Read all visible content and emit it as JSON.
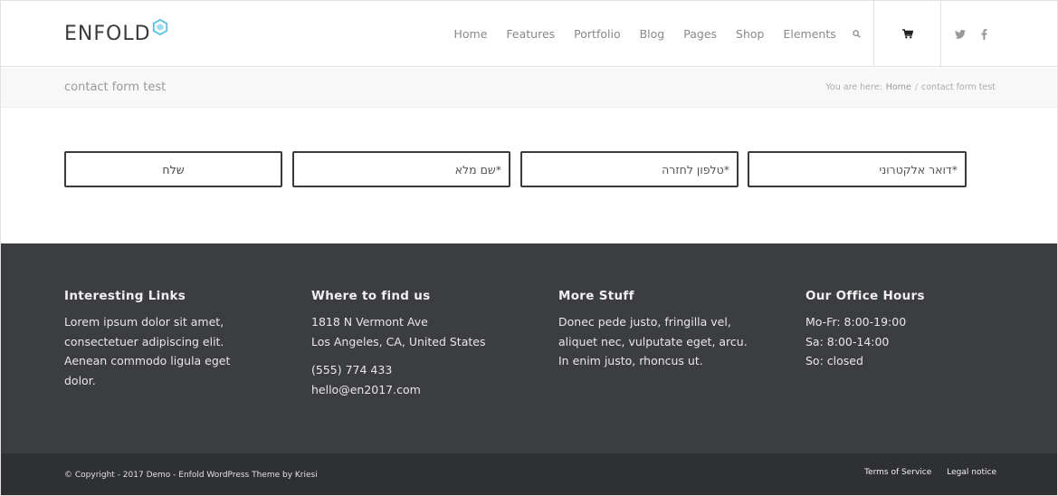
{
  "header": {
    "logo_text": "ENFOLD",
    "nav": [
      "Home",
      "Features",
      "Portfolio",
      "Blog",
      "Pages",
      "Shop",
      "Elements"
    ],
    "icons": {
      "search": "search-icon",
      "cart": "cart-icon",
      "twitter": "twitter-icon",
      "facebook": "facebook-icon"
    },
    "accent": "#5bc0de"
  },
  "titlebar": {
    "title": "contact form test",
    "breadcrumb_prefix": "You are here:",
    "breadcrumb_home": "Home",
    "breadcrumb_sep": "/",
    "breadcrumb_current": "contact form test"
  },
  "form": {
    "submit_label": "שלח",
    "name_placeholder": "*שם מלא",
    "phone_placeholder": "*טלפון לחזרה",
    "email_placeholder": "*דואר אלקטרוני"
  },
  "footer": {
    "col1": {
      "title": "Interesting Links",
      "text": "Lorem ipsum dolor sit amet, consectetuer adipiscing elit. Aenean commodo ligula eget dolor."
    },
    "col2": {
      "title": "Where to find us",
      "address1": "1818 N Vermont Ave",
      "address2": "Los Angeles, CA, United States",
      "phone": "(555) 774 433",
      "email": "hello@en2017.com"
    },
    "col3": {
      "title": "More Stuff",
      "text": "Donec pede justo, fringilla vel, aliquet nec, vulputate eget, arcu. In enim justo, rhoncus ut."
    },
    "col4": {
      "title": "Our Office Hours",
      "line1": "Mo-Fr: 8:00-19:00",
      "line2": "Sa: 8:00-14:00",
      "line3": "So: closed"
    }
  },
  "socket": {
    "copyright": "© Copyright - 2017 Demo - Enfold WordPress Theme by Kriesi",
    "links": [
      "Terms of Service",
      "Legal notice"
    ]
  }
}
